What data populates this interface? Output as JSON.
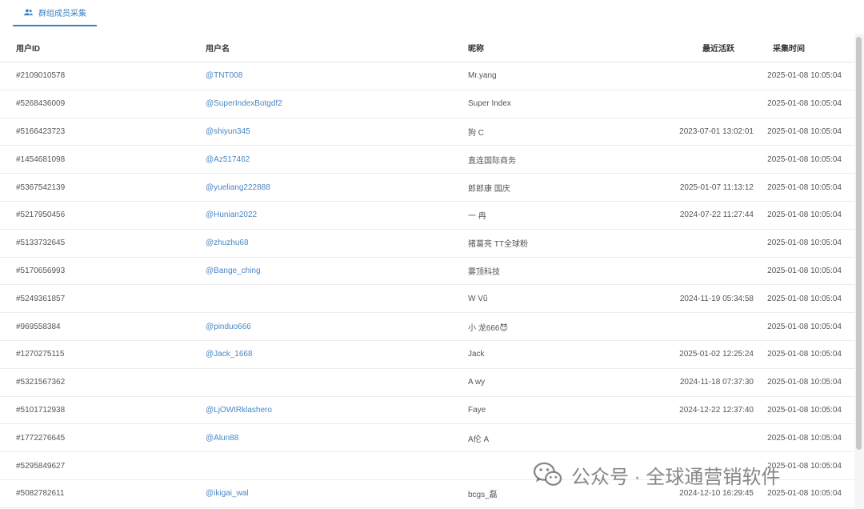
{
  "tab": {
    "label": "群组成员采集"
  },
  "columns": {
    "id": "用户ID",
    "username": "用户名",
    "nickname": "昵称",
    "last_active": "最近活跃",
    "collected": "采集时间"
  },
  "rows": [
    {
      "id": "#2109010578",
      "username": "@TNT008",
      "nickname": "Mr.yang",
      "last_active": "",
      "collected": "2025-01-08 10:05:04"
    },
    {
      "id": "#5268436009",
      "username": "@SuperIndexBotgdf2",
      "nickname": "Super Index",
      "last_active": "",
      "collected": "2025-01-08 10:05:04"
    },
    {
      "id": "#5166423723",
      "username": "@shiyun345",
      "nickname": "狗 C",
      "last_active": "2023-07-01 13:02:01",
      "collected": "2025-01-08 10:05:04"
    },
    {
      "id": "#1454681098",
      "username": "@Az517462",
      "nickname": "直连国际商务",
      "last_active": "",
      "collected": "2025-01-08 10:05:04"
    },
    {
      "id": "#5367542139",
      "username": "@yueliang222888",
      "nickname": "郎郎康 国庆",
      "last_active": "2025-01-07 11:13:12",
      "collected": "2025-01-08 10:05:04"
    },
    {
      "id": "#5217950456",
      "username": "@Hunian2022",
      "nickname": "一 冉",
      "last_active": "2024-07-22 11:27:44",
      "collected": "2025-01-08 10:05:04"
    },
    {
      "id": "#5133732645",
      "username": "@zhuzhu68",
      "nickname": "猪葛亮 TT全球粉",
      "last_active": "",
      "collected": "2025-01-08 10:05:04"
    },
    {
      "id": "#5170656993",
      "username": "@Bange_ching",
      "nickname": "雾顶科技",
      "last_active": "",
      "collected": "2025-01-08 10:05:04"
    },
    {
      "id": "#5249361857",
      "username": "",
      "nickname": "W Vũ",
      "last_active": "2024-11-19 05:34:58",
      "collected": "2025-01-08 10:05:04"
    },
    {
      "id": "#969558384",
      "username": "@pinduo666",
      "nickname": "小 龙666😈",
      "last_active": "",
      "collected": "2025-01-08 10:05:04"
    },
    {
      "id": "#1270275115",
      "username": "@Jack_1668",
      "nickname": "Jack",
      "last_active": "2025-01-02 12:25:24",
      "collected": "2025-01-08 10:05:04"
    },
    {
      "id": "#5321567362",
      "username": "",
      "nickname": "A wy",
      "last_active": "2024-11-18 07:37:30",
      "collected": "2025-01-08 10:05:04"
    },
    {
      "id": "#5101712938",
      "username": "@LjOWtRklashero",
      "nickname": "Faye",
      "last_active": "2024-12-22 12:37:40",
      "collected": "2025-01-08 10:05:04"
    },
    {
      "id": "#1772276645",
      "username": "@Alun88",
      "nickname": "A伦 A",
      "last_active": "",
      "collected": "2025-01-08 10:05:04"
    },
    {
      "id": "#5295849627",
      "username": "",
      "nickname": "",
      "last_active": "",
      "collected": "2025-01-08 10:05:04"
    },
    {
      "id": "#5082782611",
      "username": "@ikigai_wal",
      "nickname": "bcgs_磊",
      "last_active": "2024-12-10 16:29:45",
      "collected": "2025-01-08 10:05:04"
    }
  ],
  "watermark": {
    "text": "公众号 · 全球通营销软件"
  },
  "colors": {
    "accent": "#3b82c4",
    "link": "#4a86c5",
    "border": "#ececec"
  },
  "icons": {
    "tab": "group-icon",
    "watermark": "wechat-icon"
  }
}
